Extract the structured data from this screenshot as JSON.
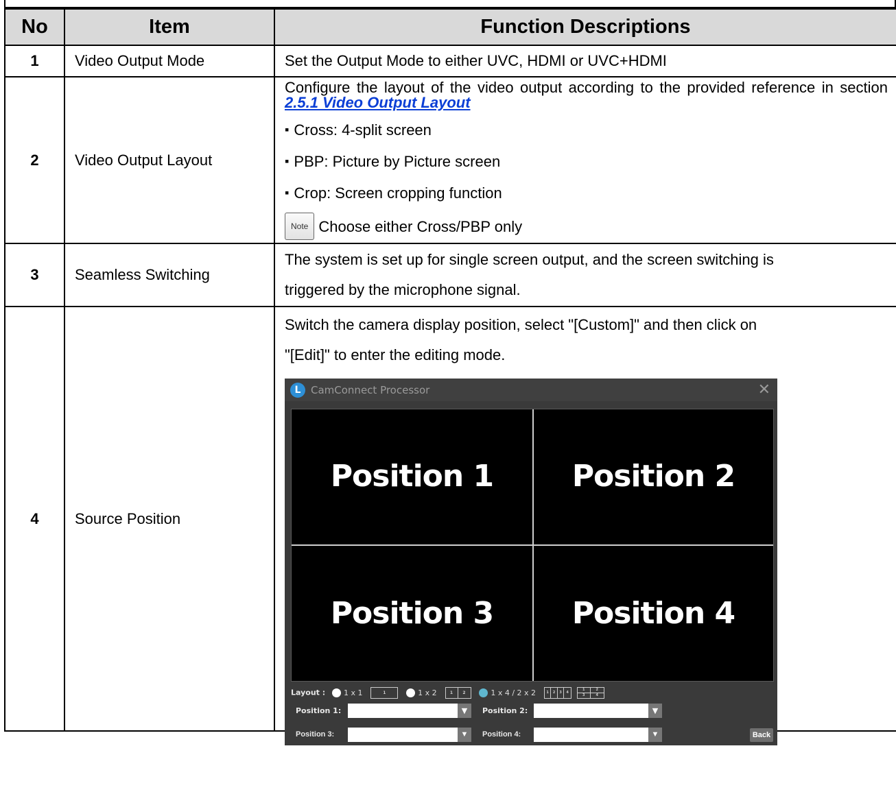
{
  "headers": {
    "no": "No",
    "item": "Item",
    "desc": "Function Descriptions"
  },
  "rows": [
    {
      "no": "1",
      "item": "Video Output Mode",
      "desc": "Set the Output Mode to either UVC, HDMI or UVC+HDMI"
    },
    {
      "no": "2",
      "item": "Video Output Layout",
      "desc_line1": "Configure the layout of the video output according to the provided reference in section",
      "desc_link": "2.5.1 Video Output Layout",
      "bullets": [
        "Cross: 4-split screen",
        "PBP: Picture by Picture screen",
        "Crop: Screen cropping function"
      ],
      "note_badge": "Note",
      "note_text": "Choose either Cross/PBP only"
    },
    {
      "no": "3",
      "item": "Seamless Switching",
      "desc_line1": "The system is set up for single screen output, and the screen switching is",
      "desc_line2": "triggered by the microphone signal."
    },
    {
      "no": "4",
      "item": "Source Position",
      "desc_line1": "Switch the camera display position, select \"[Custom]\" and then click on",
      "desc_line2": "\"[Edit]\" to enter the editing mode."
    }
  ],
  "app": {
    "title": "CamConnect Processor",
    "logo_letter": "L",
    "close": "✕",
    "positions": [
      "Position 1",
      "Position 2",
      "Position 3",
      "Position 4"
    ],
    "layout_label": "Layout :",
    "layout_options": [
      "1 x 1",
      "1 x 2",
      "1 x 4 / 2 x 2"
    ],
    "mini_1x1": [
      "1"
    ],
    "mini_1x2": [
      "1",
      "2"
    ],
    "mini_1x4": [
      "1",
      "2",
      "3",
      "4"
    ],
    "mini_2x2": [
      "1",
      "2",
      "3",
      "4"
    ],
    "selected_layout": "1 x 4 / 2 x 2",
    "fields": [
      "Position 1:",
      "Position 2:",
      "Position 3:",
      "Position 4:"
    ],
    "dropdown_arrow": "▼",
    "back": "Back"
  },
  "colors": {
    "header_bg": "#d9d9d9",
    "link": "#0b3fd6",
    "app_bg": "#3a3a3a",
    "radio_selected": "#5fb7cf"
  }
}
